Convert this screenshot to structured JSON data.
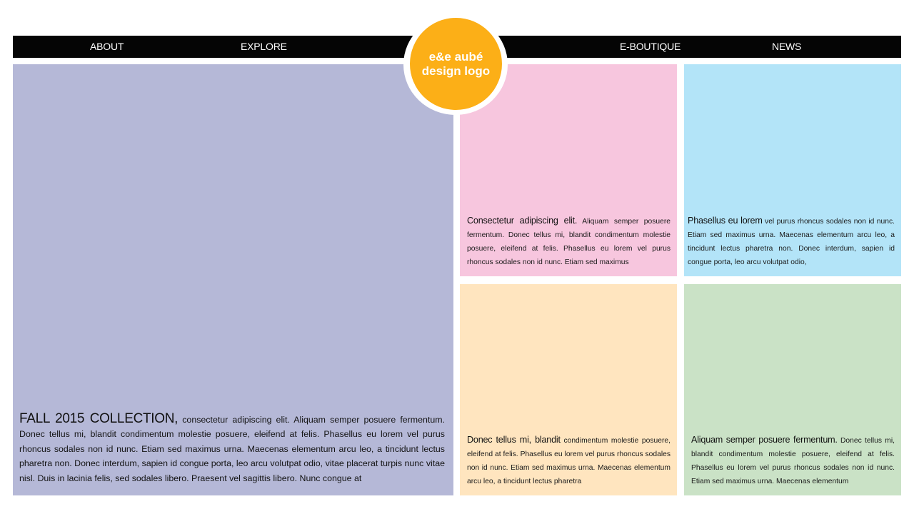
{
  "nav": {
    "about": "ABOUT",
    "explore": "EXPLORE",
    "eboutique": "E-BOUTIQUE",
    "news": "NEWS"
  },
  "logo": {
    "text": "e&e aubé design logo"
  },
  "colors": {
    "nav_background": "#050505",
    "logo": "#fcaf17",
    "large_panel": "#b5b8d7",
    "pink_panel": "#f7c6de",
    "blue_panel": "#b3e4f8",
    "peach_panel": "#ffe5bf",
    "green_panel": "#cae2c6"
  },
  "featured": {
    "lead": "FALL 2015 COLLECTION,",
    "body": " consectetur adipiscing elit. Aliquam semper posuere fermentum. Donec tellus mi, blandit condimentum molestie posuere, eleifend at felis. Phasellus eu lorem vel purus rhoncus sodales non id nunc. Etiam sed maximus urna. Maecenas elementum arcu leo, a tincidunt lectus pharetra non. Donec interdum, sapien id congue porta, leo arcu volutpat odio, vitae placerat turpis nunc vitae nisl. Duis in lacinia felis, sed sodales libero. Praesent vel sagittis libero. Nunc congue at"
  },
  "cards": {
    "pink": {
      "lead": "Consectetur adipiscing elit.",
      "body": " Aliquam semper posuere fermentum. Donec tellus mi, blandit condimentum molestie posuere, eleifend at felis. Phasellus eu lorem vel purus rhoncus sodales non id nunc. Etiam sed maximus"
    },
    "blue": {
      "lead": "Phasellus eu lorem",
      "body": " vel purus rhoncus sodales non id nunc. Etiam sed maximus urna. Maecenas elementum arcu leo, a tincidunt lectus pharetra non. Donec interdum, sapien id congue porta, leo arcu volutpat odio,"
    },
    "peach": {
      "lead": "Donec tellus mi, blandit",
      "body": " condimentum molestie posuere, eleifend at felis. Phasellus eu lorem vel purus rhoncus sodales non id nunc. Etiam sed maximus urna. Maecenas elementum arcu leo, a tincidunt lectus pharetra"
    },
    "green": {
      "lead": "Aliquam semper posuere fermentum.",
      "body": " Donec tellus mi, blandit condimentum molestie posuere, eleifend at felis. Phasellus eu lorem vel purus rhoncus sodales non id nunc. Etiam sed maximus urna. Maecenas elementum"
    }
  }
}
